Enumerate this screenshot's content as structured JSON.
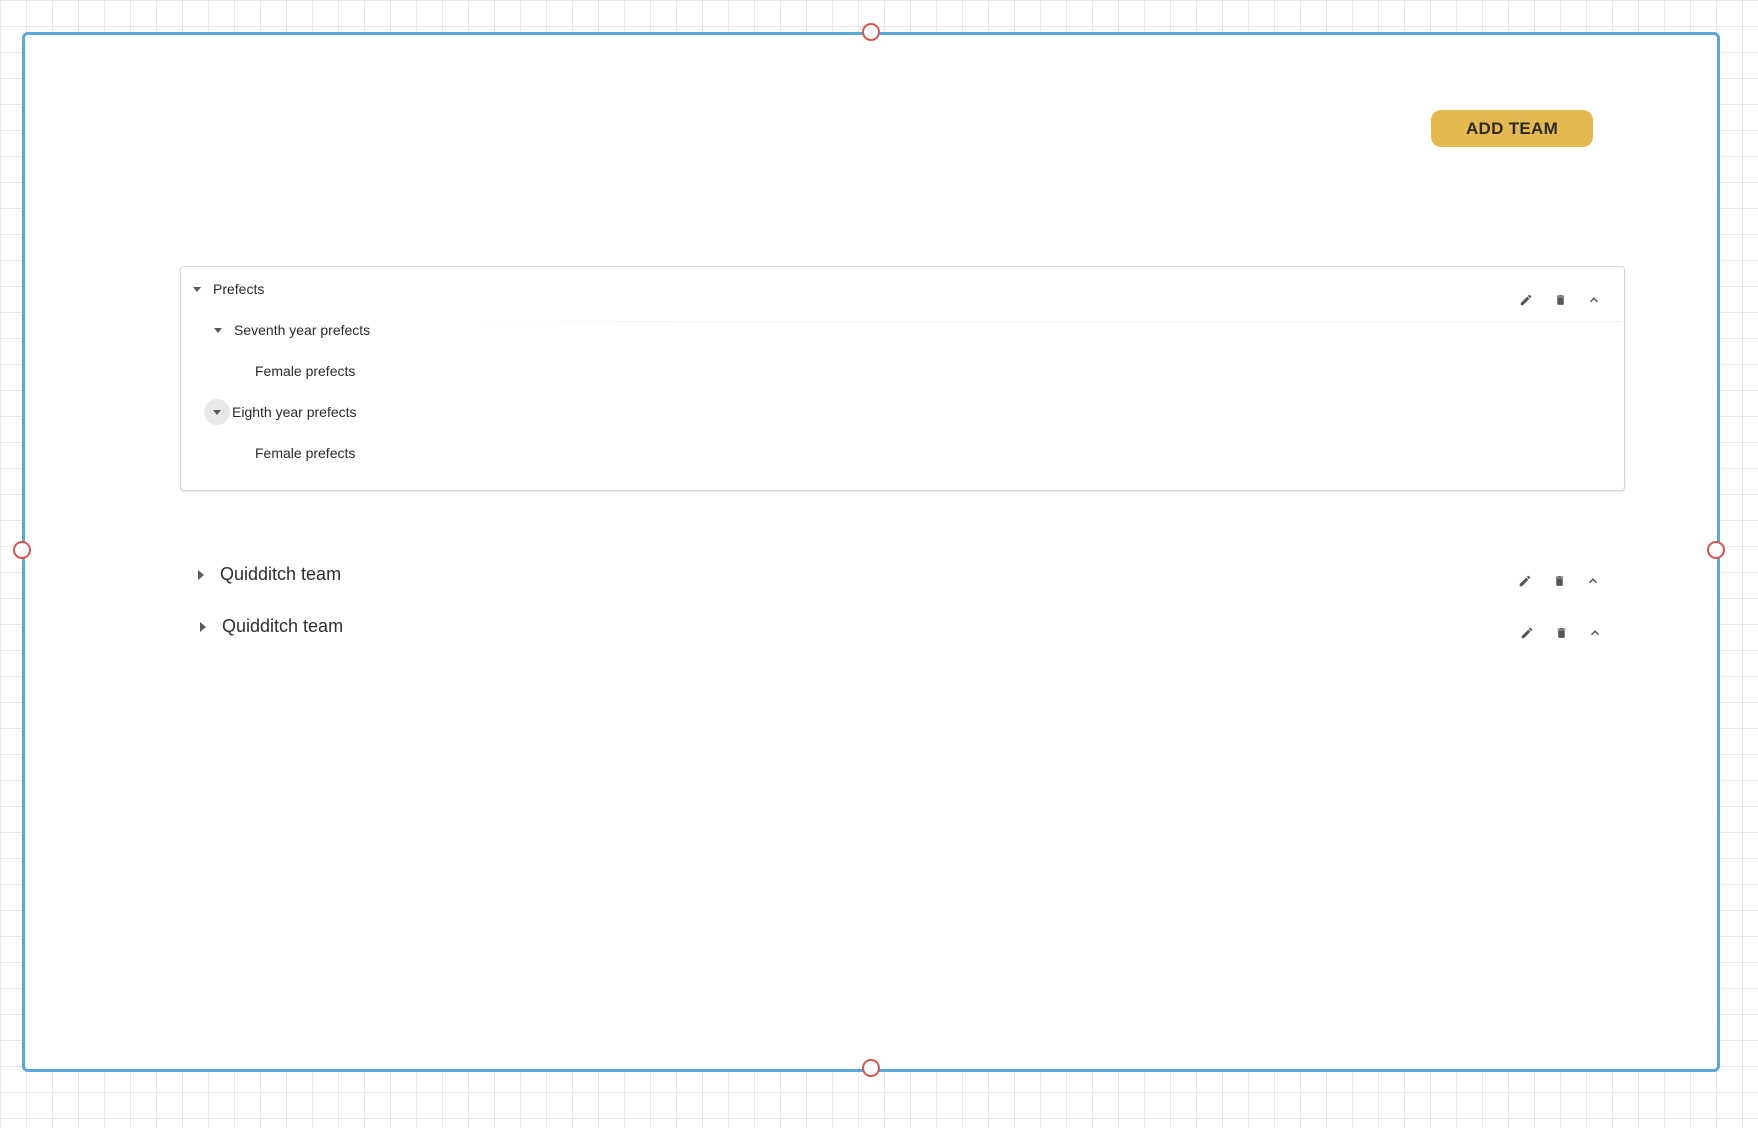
{
  "toolbar": {
    "add_team_label": "ADD TEAM",
    "accent_color": "#e4b94f"
  },
  "frame": {
    "border_color": "#5aa9dc",
    "handle_color": "#d9534f"
  },
  "tree": {
    "root": {
      "label": "Prefects",
      "expanded": true
    },
    "children": [
      {
        "label": "Seventh year prefects",
        "expanded": true,
        "children": [
          {
            "label": "Female prefects"
          }
        ]
      },
      {
        "label": "Eighth year prefects",
        "expanded": true,
        "hovered": true,
        "children": [
          {
            "label": "Female prefects"
          }
        ]
      }
    ],
    "actions": [
      "pencil-icon",
      "trash-icon",
      "chevron-up-icon"
    ]
  },
  "teams": [
    {
      "label": "Quidditch team",
      "expanded": false,
      "actions": [
        "pencil-icon",
        "trash-icon",
        "chevron-up-icon"
      ]
    },
    {
      "label": "Quidditch team",
      "expanded": false,
      "actions": [
        "pencil-icon",
        "trash-icon",
        "chevron-up-icon"
      ]
    }
  ]
}
